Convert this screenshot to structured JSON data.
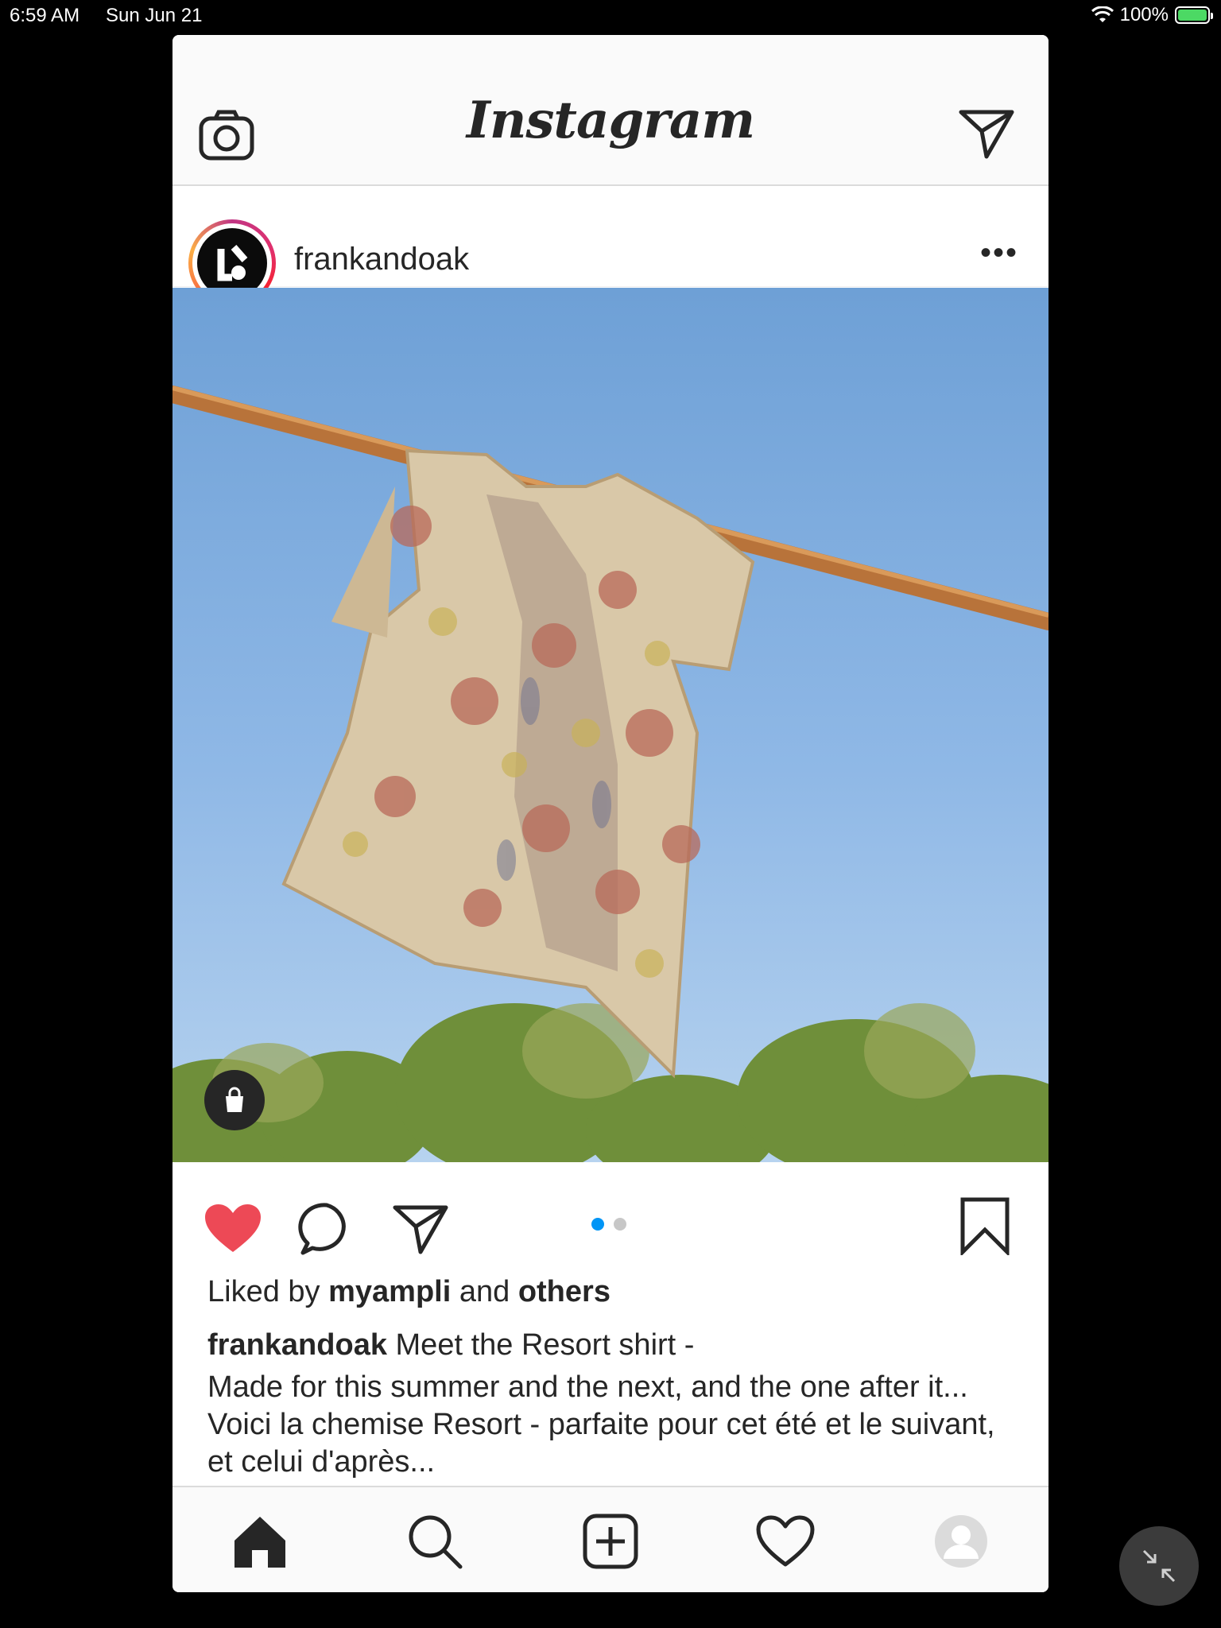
{
  "status": {
    "time": "6:59 AM",
    "date": "Sun Jun 21",
    "battery": "100%"
  },
  "app": {
    "logo": "Instagram"
  },
  "post": {
    "username": "frankandoak",
    "more_label": "•••",
    "liked_prefix": "Liked by",
    "liked_user": "myampli",
    "liked_and": "and",
    "liked_others": "others",
    "caption_user": "frankandoak",
    "caption_line1": "Meet the Resort shirt -",
    "caption_body": "Made for this summer and the next, and the one after it... Voici la chemise Resort - parfaite pour cet été et le suivant, et celui d'après...",
    "carousel": {
      "count": 2,
      "active_index": 0
    },
    "liked": true
  },
  "colors": {
    "like": "#ed4956",
    "active_dot": "#0095f6",
    "sky": "#8fb8e6"
  },
  "icons": [
    "camera-icon",
    "direct-icon",
    "more-icon",
    "shopping-bag-icon",
    "heart-icon",
    "comment-icon",
    "share-icon",
    "bookmark-icon",
    "home-icon",
    "search-icon",
    "add-icon",
    "activity-icon",
    "profile-icon",
    "minimize-icon"
  ]
}
